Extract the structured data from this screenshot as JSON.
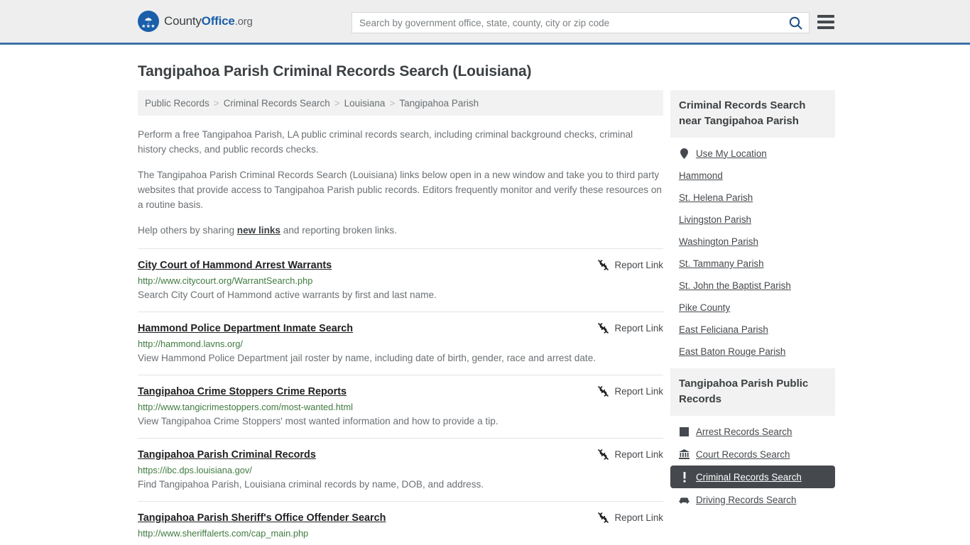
{
  "header": {
    "logo": {
      "prefix": "County",
      "bold": "Office",
      "suffix": ".org",
      "eagle_icon": "eagle-icon",
      "stars": "★★★"
    },
    "search": {
      "placeholder": "Search by government office, state, county, city or zip code",
      "value": "",
      "search_icon": "search-icon"
    },
    "menu_icon": "hamburger-menu-icon"
  },
  "page": {
    "title": "Tangipahoa Parish Criminal Records Search (Louisiana)",
    "breadcrumb": [
      "Public Records",
      "Criminal Records Search",
      "Louisiana",
      "Tangipahoa Parish"
    ],
    "breadcrumb_separator": ">",
    "intro": [
      "Perform a free Tangipahoa Parish, LA public criminal records search, including criminal background checks, criminal history checks, and public records checks.",
      "The Tangipahoa Parish Criminal Records Search (Louisiana) links below open in a new window and take you to third party websites that provide access to Tangipahoa Parish public records. Editors frequently monitor and verify these resources on a routine basis."
    ],
    "help_line": {
      "before": "Help others by sharing ",
      "link": "new links",
      "after": " and reporting broken links."
    }
  },
  "report_link_label": "Report Link",
  "report_link_icon": "broken-link-icon",
  "results": [
    {
      "title": "City Court of Hammond Arrest Warrants",
      "url": "http://www.citycourt.org/WarrantSearch.php",
      "description": "Search City Court of Hammond active warrants by first and last name."
    },
    {
      "title": "Hammond Police Department Inmate Search",
      "url": "http://hammond.lavns.org/",
      "description": "View Hammond Police Department jail roster by name, including date of birth, gender, race and arrest date."
    },
    {
      "title": "Tangipahoa Crime Stoppers Crime Reports",
      "url": "http://www.tangicrimestoppers.com/most-wanted.html",
      "description": "View Tangipahoa Crime Stoppers' most wanted information and how to provide a tip."
    },
    {
      "title": "Tangipahoa Parish Criminal Records",
      "url": "https://ibc.dps.louisiana.gov/",
      "description": "Find Tangipahoa Parish, Louisiana criminal records by name, DOB, and address."
    },
    {
      "title": "Tangipahoa Parish Sheriff's Office Offender Search",
      "url": "http://www.sheriffalerts.com/cap_main.php",
      "description": ""
    }
  ],
  "sidebar": {
    "nearby": {
      "heading": "Criminal Records Search near Tangipahoa Parish",
      "use_my_location": {
        "label": "Use My Location",
        "icon": "map-pin-icon"
      },
      "items": [
        "Hammond",
        "St. Helena Parish",
        "Livingston Parish",
        "Washington Parish",
        "St. Tammany Parish",
        "St. John the Baptist Parish",
        "Pike County",
        "East Feliciana Parish",
        "East Baton Rouge Parish"
      ]
    },
    "public_records": {
      "heading": "Tangipahoa Parish Public Records",
      "items": [
        {
          "label": "Arrest Records Search",
          "icon": "square-icon",
          "active": false
        },
        {
          "label": "Court Records Search",
          "icon": "courthouse-icon",
          "active": false
        },
        {
          "label": "Criminal Records Search",
          "icon": "exclamation-icon",
          "active": true
        },
        {
          "label": "Driving Records Search",
          "icon": "car-icon",
          "active": false
        }
      ]
    }
  },
  "colors": {
    "header_bg": "#eeeeee",
    "header_border": "#3c72a8",
    "accent_blue": "#1b5faa",
    "url_green": "#3f7a3f",
    "active_bg": "#45494d",
    "panel_bg": "#f2f2f2"
  }
}
